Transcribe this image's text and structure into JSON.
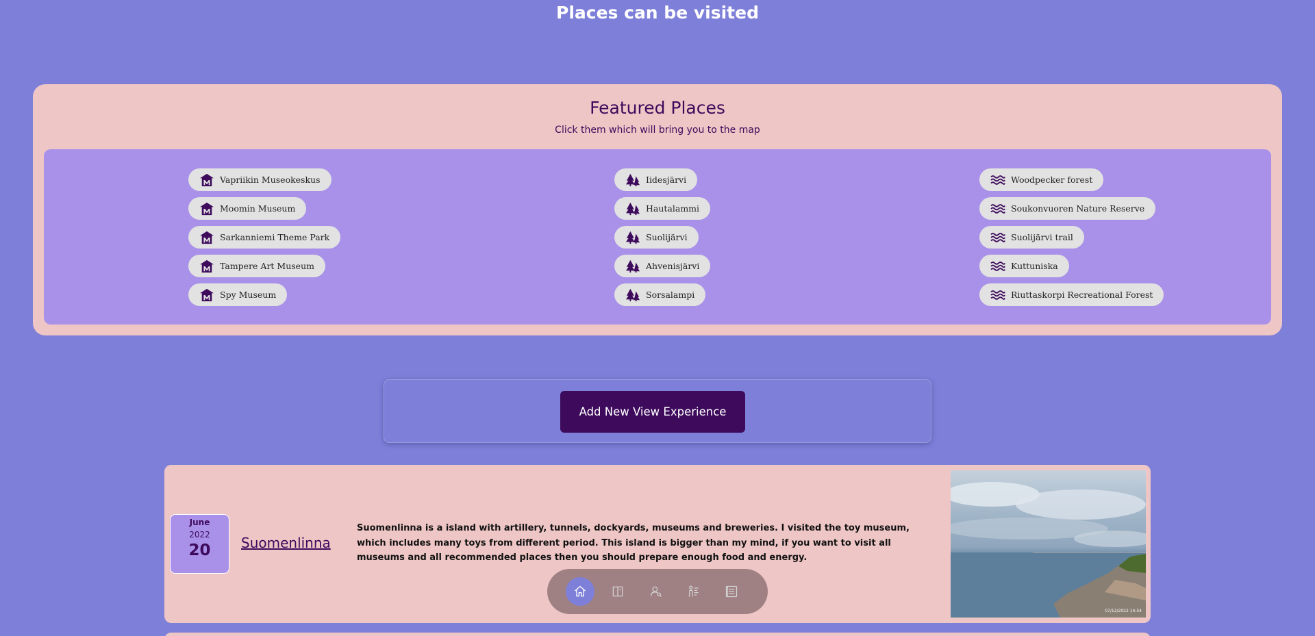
{
  "header": {
    "title": "Places can be visited"
  },
  "featured": {
    "title": "Featured Places",
    "subtitle": "Click them which will bring you to the map",
    "museums": [
      "Vapriikin Museokeskus",
      "Moomin Museum",
      "Sarkanniemi Theme Park",
      "Tampere Art Museum",
      "Spy Museum"
    ],
    "lakes": [
      "Iidesjärvi",
      "Hautalammi",
      "Suolijärvi",
      "Ahvenisjärvi",
      "Sorsalampi"
    ],
    "forests": [
      "Woodpecker forest",
      "Soukonvuoren Nature Reserve",
      "Suolijärvi trail",
      "Kuttuniska",
      "Riuttaskorpi Recreational Forest"
    ]
  },
  "actions": {
    "add_label": "Add New View Experience"
  },
  "experience": {
    "month": "June",
    "year": "2022",
    "day": "20",
    "title": "Suomenlinna",
    "description": "Suomenlinna is a island with artillery, tunnels, dockyards, museums and breweries. I visited the toy museum, which includes many toys from different period. This island is bigger than my mind, if you want to visit all museums and all recommended places then you should prepare enough food and energy.",
    "photo_stamp": "07/12/2022  14:54"
  },
  "icons": {
    "museum": "museum-icon",
    "lake": "pine-trees-icon",
    "forest": "waves-icon",
    "nav": [
      "home-icon",
      "book-icon",
      "user-search-icon",
      "person-chart-icon",
      "list-icon"
    ]
  },
  "colors": {
    "background": "#7d7fd9",
    "panel": "#eec6c5",
    "inner_panel": "#a991ea",
    "accent": "#3d0a5c",
    "chip": "#e2e2e2",
    "nav_bar": "#a08183"
  }
}
